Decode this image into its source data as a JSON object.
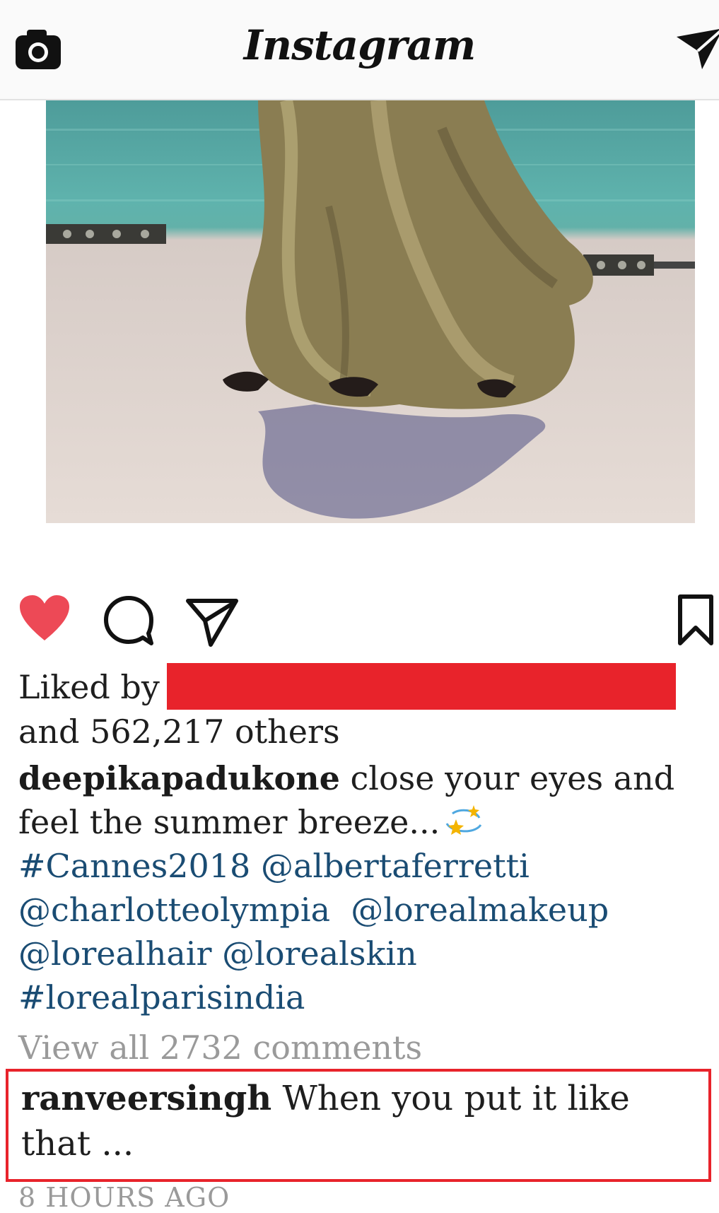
{
  "app": {
    "title": "Instagram",
    "camera_icon": "camera-icon",
    "direct_icon": "paper-plane-icon"
  },
  "post": {
    "image_alt": "photo-post",
    "liked_by_prefix": "Liked by",
    "likes_suffix": "and 562,217 others",
    "author": "deepikapadukone",
    "caption_text": "close your eyes and feel the summer breeze...",
    "tags": {
      "cannes": "#Cannes2018",
      "alberta": "@albertaferretti",
      "charlotte": "@charlotteolympia",
      "lorealmakeup": "@lorealmakeup",
      "lorealhair": "@lorealhair",
      "lorealskin": "@lorealskin",
      "lorealindia": "#lorealparisindia"
    },
    "view_all_comments": "View all 2732 comments",
    "comment": {
      "user": "ranveersingh",
      "text": "When you put it like that ..."
    },
    "timestamp": "8 HOURS AGO"
  },
  "colors": {
    "like_red": "#ed4956",
    "redaction": "#e8232b",
    "tag_blue": "#1a4c73"
  }
}
